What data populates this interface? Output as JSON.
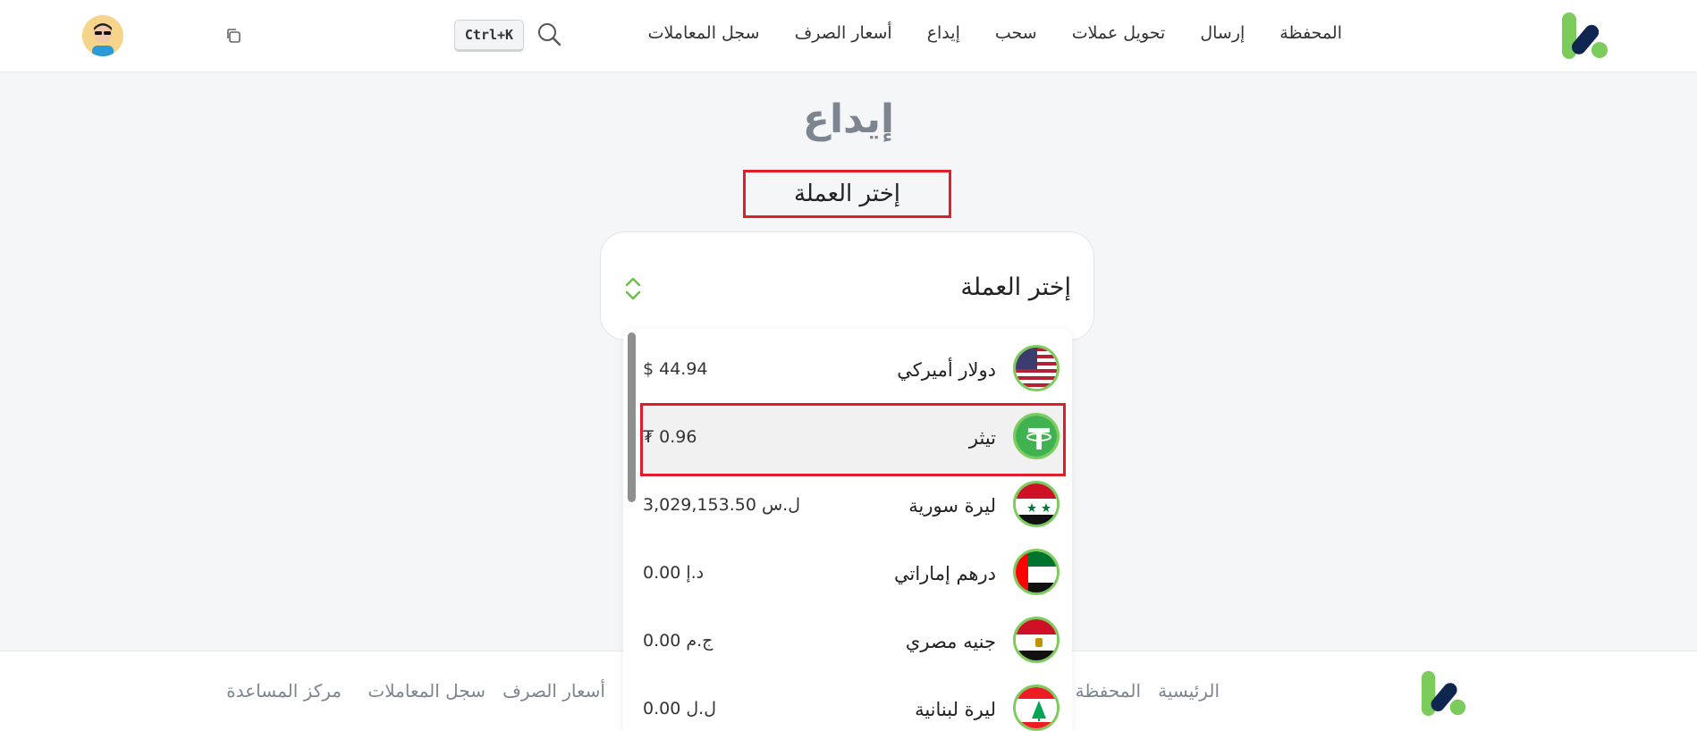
{
  "header": {
    "nav": [
      "المحفظة",
      "إرسال",
      "تحويل عملات",
      "سحب",
      "إيداع",
      "أسعار الصرف",
      "سجل المعاملات"
    ],
    "shortcut": "Ctrl+K"
  },
  "main": {
    "title": "إيداع",
    "section_label": "إختر العملة",
    "select_label": "إختر العملة"
  },
  "currencies": [
    {
      "name": "دولار أميركي",
      "amount": "$ 44.94",
      "flag": "us-flag-icon"
    },
    {
      "name": "تيثر",
      "amount": "₮ 0.96",
      "flag": "tether-icon",
      "selected": true
    },
    {
      "name": "ليرة سورية",
      "amount": "ل.س 3,029,153.50",
      "flag": "syria-flag-icon"
    },
    {
      "name": "درهم إماراتي",
      "amount": "د.إ 0.00",
      "flag": "uae-flag-icon"
    },
    {
      "name": "جنيه مصري",
      "amount": "ج.م 0.00",
      "flag": "egypt-flag-icon"
    },
    {
      "name": "ليرة لبنانية",
      "amount": "ل.ل 0.00",
      "flag": "lebanon-flag-icon"
    }
  ],
  "footer": {
    "links": [
      "الرئيسية",
      "المحفظة",
      "أسعار الصرف",
      "سجل المعاملات",
      "مركز المساعدة"
    ]
  },
  "colors": {
    "accent": "#e01e2b",
    "brand_green": "#7ccc5c",
    "brand_navy": "#0f2650"
  }
}
